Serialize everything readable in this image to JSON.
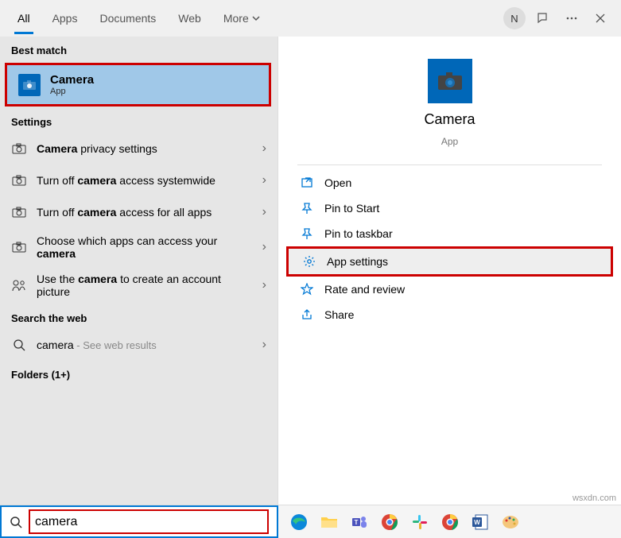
{
  "tabs": {
    "all": "All",
    "apps": "Apps",
    "documents": "Documents",
    "web": "Web",
    "more": "More"
  },
  "titlebar": {
    "avatar_initial": "N"
  },
  "left": {
    "best_match_header": "Best match",
    "best": {
      "title": "Camera",
      "sub": "App"
    },
    "settings_header": "Settings",
    "s1_bold": "Camera",
    "s1_rest": " privacy settings",
    "s2_a": "Turn off ",
    "s2_b": "camera",
    "s2_c": " access systemwide",
    "s3_a": "Turn off ",
    "s3_b": "camera",
    "s3_c": " access for all apps",
    "s4_a": "Choose which apps can access your",
    "s4_b": "camera",
    "s5_a": "Use the ",
    "s5_b": "camera",
    "s5_c": " to create an account",
    "s5_d": "picture",
    "web_header": "Search the web",
    "web_bold": "camera",
    "web_rest": " - See web results",
    "folders_header": "Folders (1+)"
  },
  "right": {
    "title": "Camera",
    "type": "App",
    "actions": {
      "open": "Open",
      "pin_start": "Pin to Start",
      "pin_taskbar": "Pin to taskbar",
      "app_settings": "App settings",
      "rate": "Rate and review",
      "share": "Share"
    }
  },
  "search": {
    "value": "camera"
  },
  "watermark": "wsxdn.com"
}
